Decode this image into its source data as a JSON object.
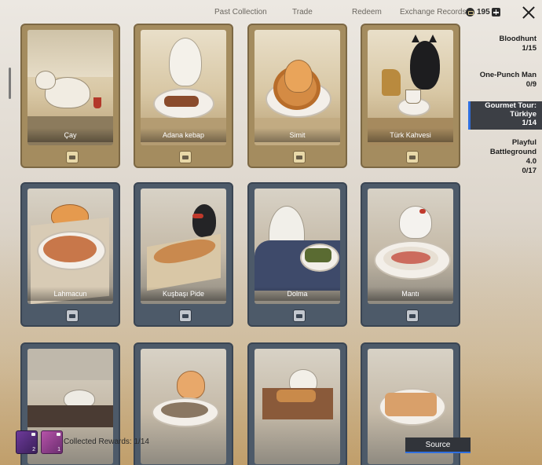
{
  "nav": {
    "tabs": [
      "Past Collection",
      "Trade",
      "Redeem",
      "Exchange Records"
    ],
    "coins": "195"
  },
  "cards": [
    {
      "name": "Çay",
      "style": "gold"
    },
    {
      "name": "Adana kebap",
      "style": "gold"
    },
    {
      "name": "Simit",
      "style": "gold"
    },
    {
      "name": "Türk Kahvesi",
      "style": "gold"
    },
    {
      "name": "Lahmacun",
      "style": "blue"
    },
    {
      "name": "Kuşbaşı Pide",
      "style": "blue"
    },
    {
      "name": "Dolma",
      "style": "blue"
    },
    {
      "name": "Mantı",
      "style": "blue"
    },
    {
      "name": "",
      "style": "blue"
    },
    {
      "name": "",
      "style": "blue"
    },
    {
      "name": "",
      "style": "blue"
    },
    {
      "name": "",
      "style": "blue"
    }
  ],
  "sidebar": {
    "items": [
      {
        "title": "Bloodhunt",
        "count": "1/15"
      },
      {
        "title": "One-Punch Man",
        "count": "0/9"
      },
      {
        "title": "Gourmet Tour:\nTürkiye",
        "count": "1/14",
        "active": true
      },
      {
        "title": "Playful Battleground\n4.0",
        "count": "0/17"
      }
    ]
  },
  "footer": {
    "rewards": [
      {
        "qty": "2",
        "icon": "voucher-purple-icon"
      },
      {
        "qty": "1",
        "icon": "voucher-pink-icon"
      }
    ],
    "collected_label": "Collected Rewards: 1/14",
    "source_label": "Source"
  },
  "colors": {
    "accent": "#2f6fe0",
    "gold_frame": "#a48c5f",
    "blue_frame": "#4d5a69"
  }
}
